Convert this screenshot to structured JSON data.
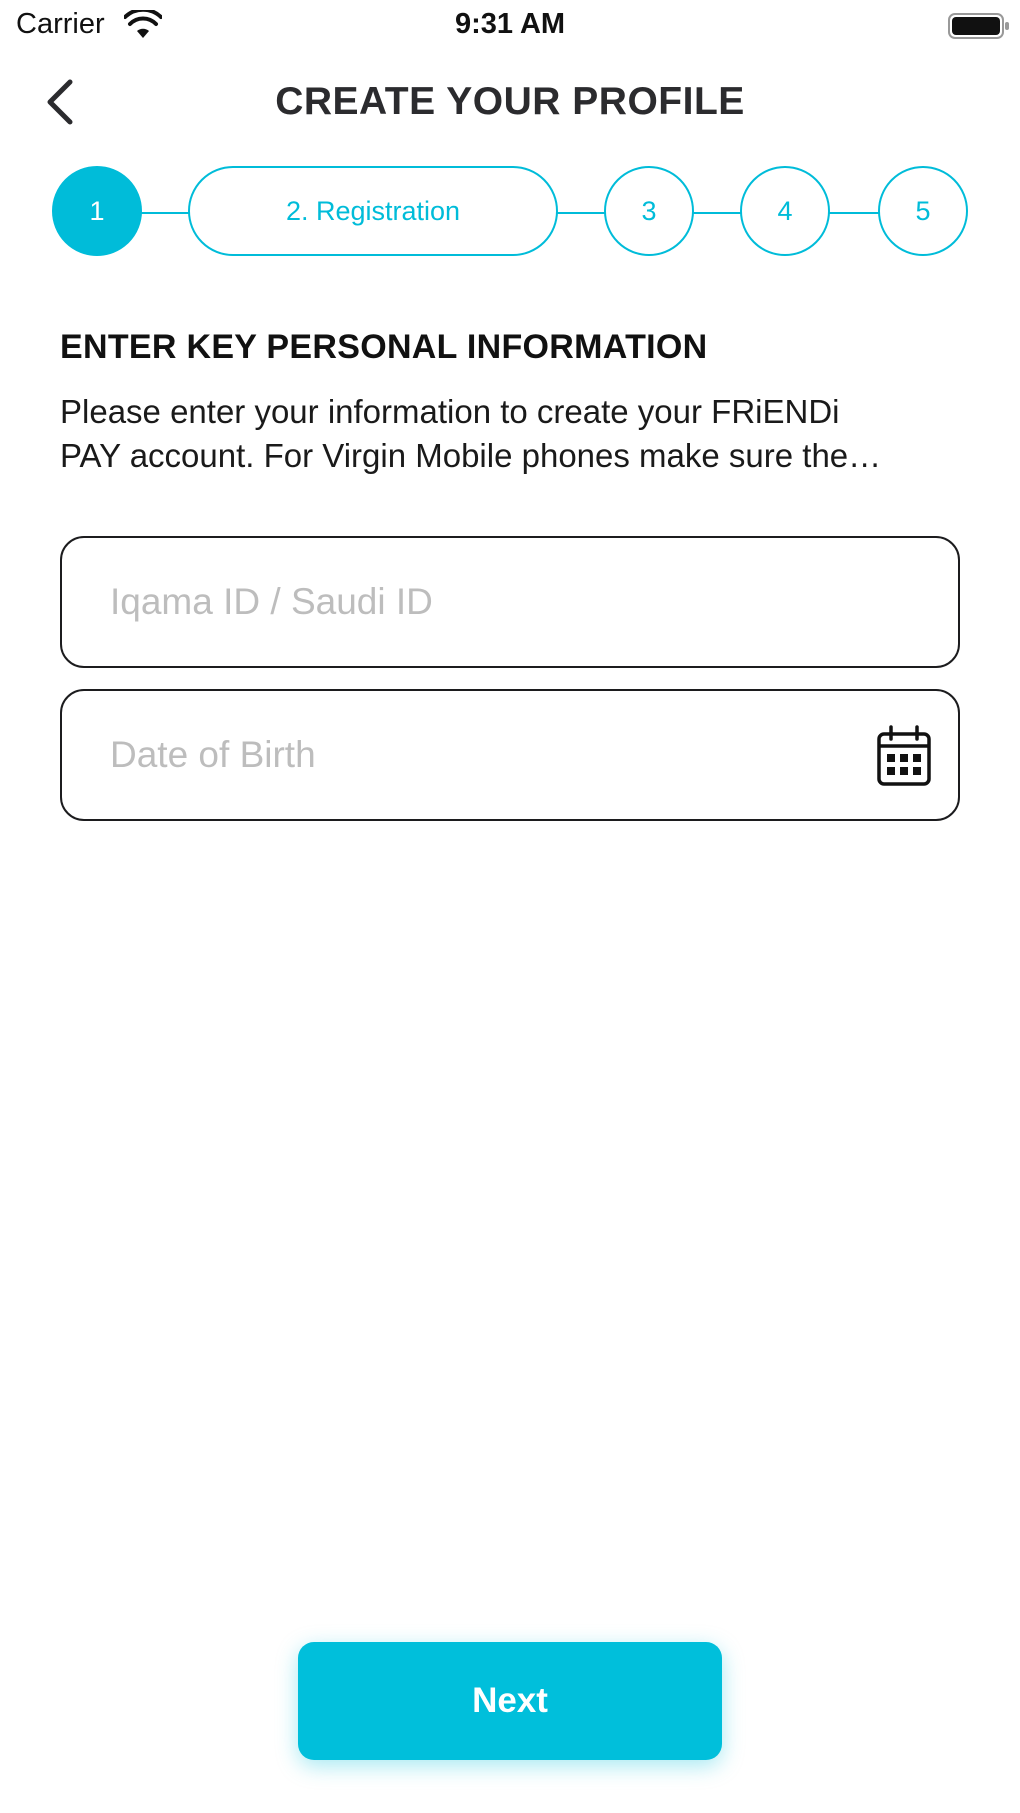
{
  "status_bar": {
    "carrier": "Carrier",
    "time": "9:31 AM",
    "wifi_icon": "wifi-icon",
    "battery_icon": "battery-icon"
  },
  "header": {
    "back_icon": "chevron-left-icon",
    "title": "CREATE YOUR PROFILE"
  },
  "stepper": {
    "accent_color": "#00bcd9",
    "steps": [
      {
        "label": "1",
        "active": true
      },
      {
        "label": "2. Registration",
        "active": false
      },
      {
        "label": "3",
        "active": false
      },
      {
        "label": "4",
        "active": false
      },
      {
        "label": "5",
        "active": false
      }
    ]
  },
  "section": {
    "heading": "ENTER KEY PERSONAL INFORMATION",
    "description_line1": "Please enter your information to create your FRiENDi",
    "description_line2": "PAY account. For Virgin Mobile phones make sure the…"
  },
  "form": {
    "id_field": {
      "placeholder": "Iqama ID / Saudi ID",
      "value": ""
    },
    "dob_field": {
      "placeholder": "Date of Birth",
      "value": "",
      "icon": "calendar-icon"
    }
  },
  "footer": {
    "next_label": "Next",
    "button_color": "#00bfdb"
  }
}
